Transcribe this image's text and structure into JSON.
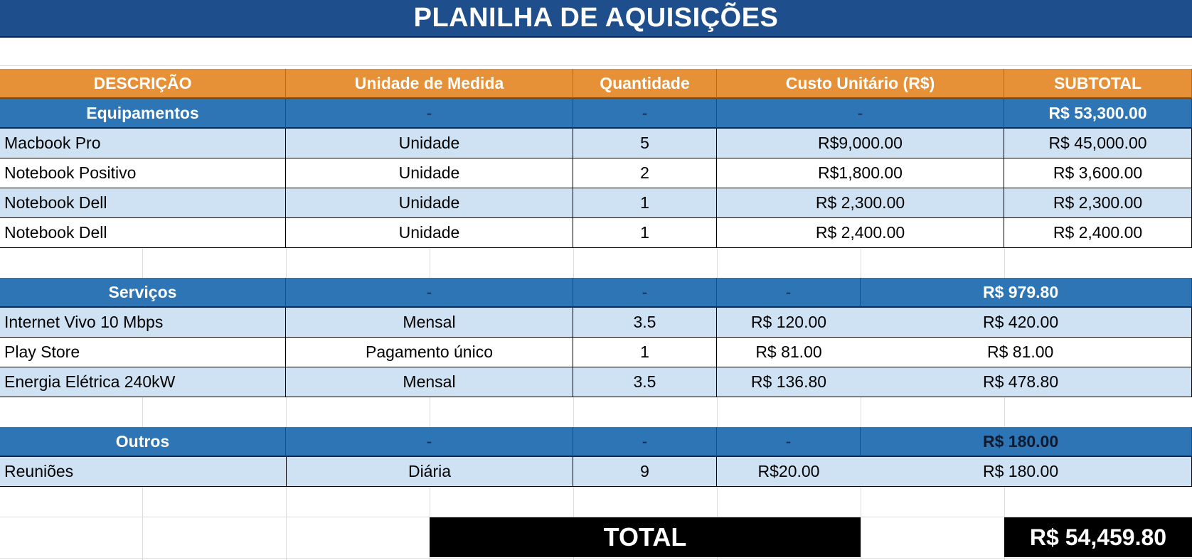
{
  "title": "PLANILHA DE AQUISIÇÕES",
  "colors": {
    "title_bg": "#1f4e8c",
    "header_bg": "#e69138",
    "category_bg": "#2e75b6",
    "row_alt_bg": "#cfe2f3",
    "total_bg": "#000000"
  },
  "headers": {
    "descricao": "DESCRIÇÃO",
    "unidade": "Unidade de Medida",
    "quantidade": "Quantidade",
    "custo": "Custo Unitário (R$)",
    "subtotal": "SUBTOTAL"
  },
  "equipamentos": {
    "name": "Equipamentos",
    "unidade": "-",
    "quantidade": "-",
    "custo": "-",
    "subtotal": "R$ 53,300.00",
    "rows": [
      {
        "descricao": "Macbook Pro",
        "unidade": "Unidade",
        "quantidade": "5",
        "custo": "R$9,000.00",
        "subtotal": "R$ 45,000.00"
      },
      {
        "descricao": "Notebook Positivo",
        "unidade": "Unidade",
        "quantidade": "2",
        "custo": "R$1,800.00",
        "subtotal": "R$ 3,600.00"
      },
      {
        "descricao": "Notebook Dell",
        "unidade": "Unidade",
        "quantidade": "1",
        "custo": "R$ 2,300.00",
        "subtotal": "R$ 2,300.00"
      },
      {
        "descricao": "Notebook Dell",
        "unidade": "Unidade",
        "quantidade": "1",
        "custo": "R$ 2,400.00",
        "subtotal": "R$ 2,400.00"
      }
    ]
  },
  "servicos": {
    "name": "Serviços",
    "unidade": "-",
    "quantidade": "-",
    "custo": "-",
    "subtotal": "R$ 979.80",
    "rows": [
      {
        "descricao": "Internet Vivo 10 Mbps",
        "unidade": "Mensal",
        "quantidade": "3.5",
        "custo": "R$ 120.00",
        "subtotal": "R$ 420.00"
      },
      {
        "descricao": "Play Store",
        "unidade": "Pagamento único",
        "quantidade": "1",
        "custo": "R$ 81.00",
        "subtotal": "R$ 81.00"
      },
      {
        "descricao": "Energia Elétrica 240kW",
        "unidade": "Mensal",
        "quantidade": "3.5",
        "custo": "R$ 136.80",
        "subtotal": "R$ 478.80"
      }
    ]
  },
  "outros": {
    "name": "Outros",
    "unidade": "-",
    "quantidade": "-",
    "custo": "-",
    "subtotal": "R$ 180.00",
    "rows": [
      {
        "descricao": "Reuniões",
        "unidade": "Diária",
        "quantidade": "9",
        "custo": "R$20.00",
        "subtotal": "R$ 180.00"
      }
    ]
  },
  "total": {
    "label": "TOTAL",
    "value": "R$ 54,459.80"
  }
}
